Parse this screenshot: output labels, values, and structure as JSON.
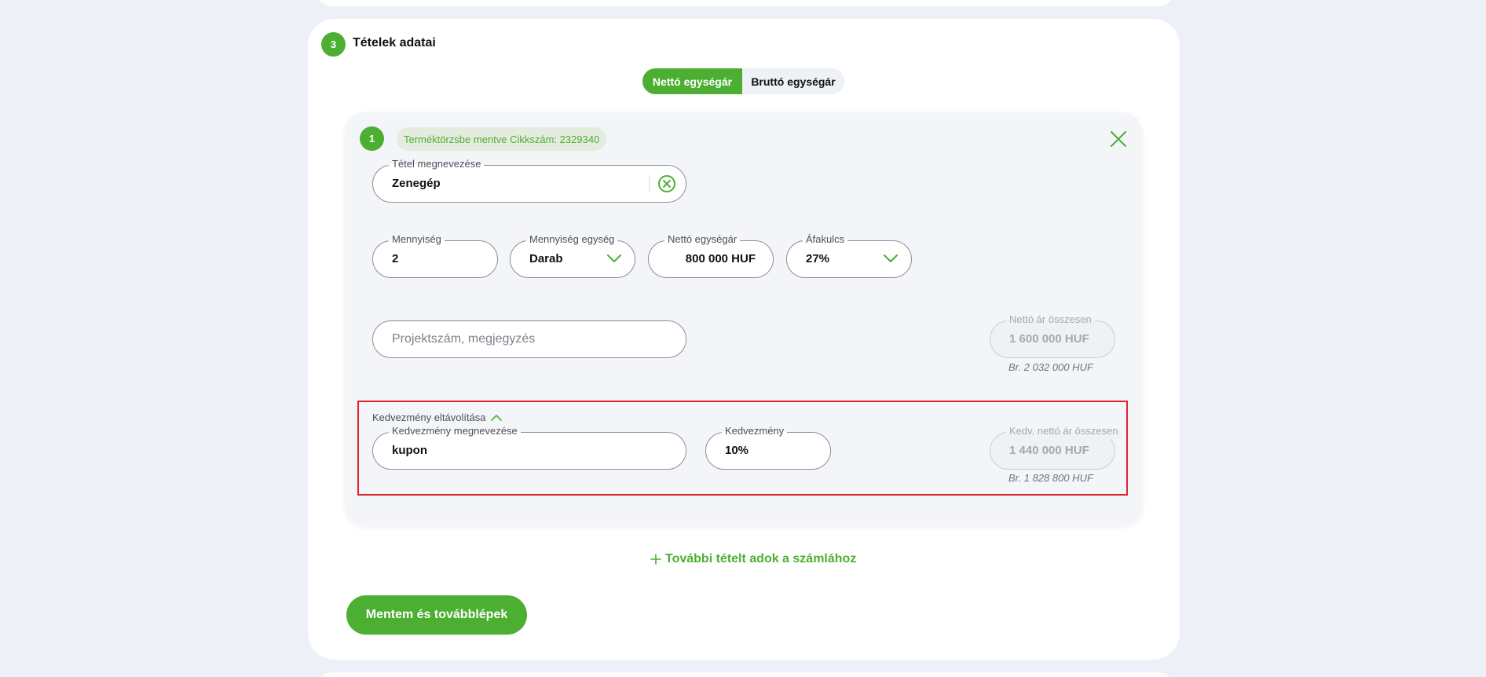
{
  "section": {
    "step_number": "3",
    "title": "Tételek adatai"
  },
  "price_toggle": {
    "options": [
      "Nettó egységár",
      "Bruttó egységár"
    ],
    "selected": "Nettó egységár"
  },
  "item": {
    "number": "1",
    "saved_badge": "Terméktörzsbe mentve Cikkszám: 2329340",
    "name": {
      "label": "Tétel megnevezése",
      "value": "Zenegép"
    },
    "quantity": {
      "label": "Mennyiség",
      "value": "2"
    },
    "unit": {
      "label": "Mennyiség egység",
      "value": "Darab"
    },
    "net_unit_price": {
      "label": "Nettó egységár",
      "value": "800 000 HUF"
    },
    "vat": {
      "label": "Áfakulcs",
      "value": "27%"
    },
    "note": {
      "placeholder": "Projektszám, megjegyzés"
    },
    "net_total": {
      "label": "Nettó ár összesen",
      "value": "1 600 000 HUF",
      "gross": "Br. 2 032 000 HUF"
    },
    "discount": {
      "remove_label": "Kedvezmény eltávolítása",
      "name": {
        "label": "Kedvezmény megnevezése",
        "value": "kupon"
      },
      "amount": {
        "label": "Kedvezmény",
        "value": "10%"
      },
      "net_total": {
        "label": "Kedv. nettó ár összesen",
        "value": "1 440 000 HUF",
        "gross": "Br. 1 828 800 HUF"
      }
    }
  },
  "actions": {
    "add_item": "További tételt adok a számlához",
    "save_continue": "Mentem és továbblépek"
  },
  "colors": {
    "accent": "#4caf32",
    "highlight_border": "#e0242b",
    "background": "#edf0f6"
  }
}
